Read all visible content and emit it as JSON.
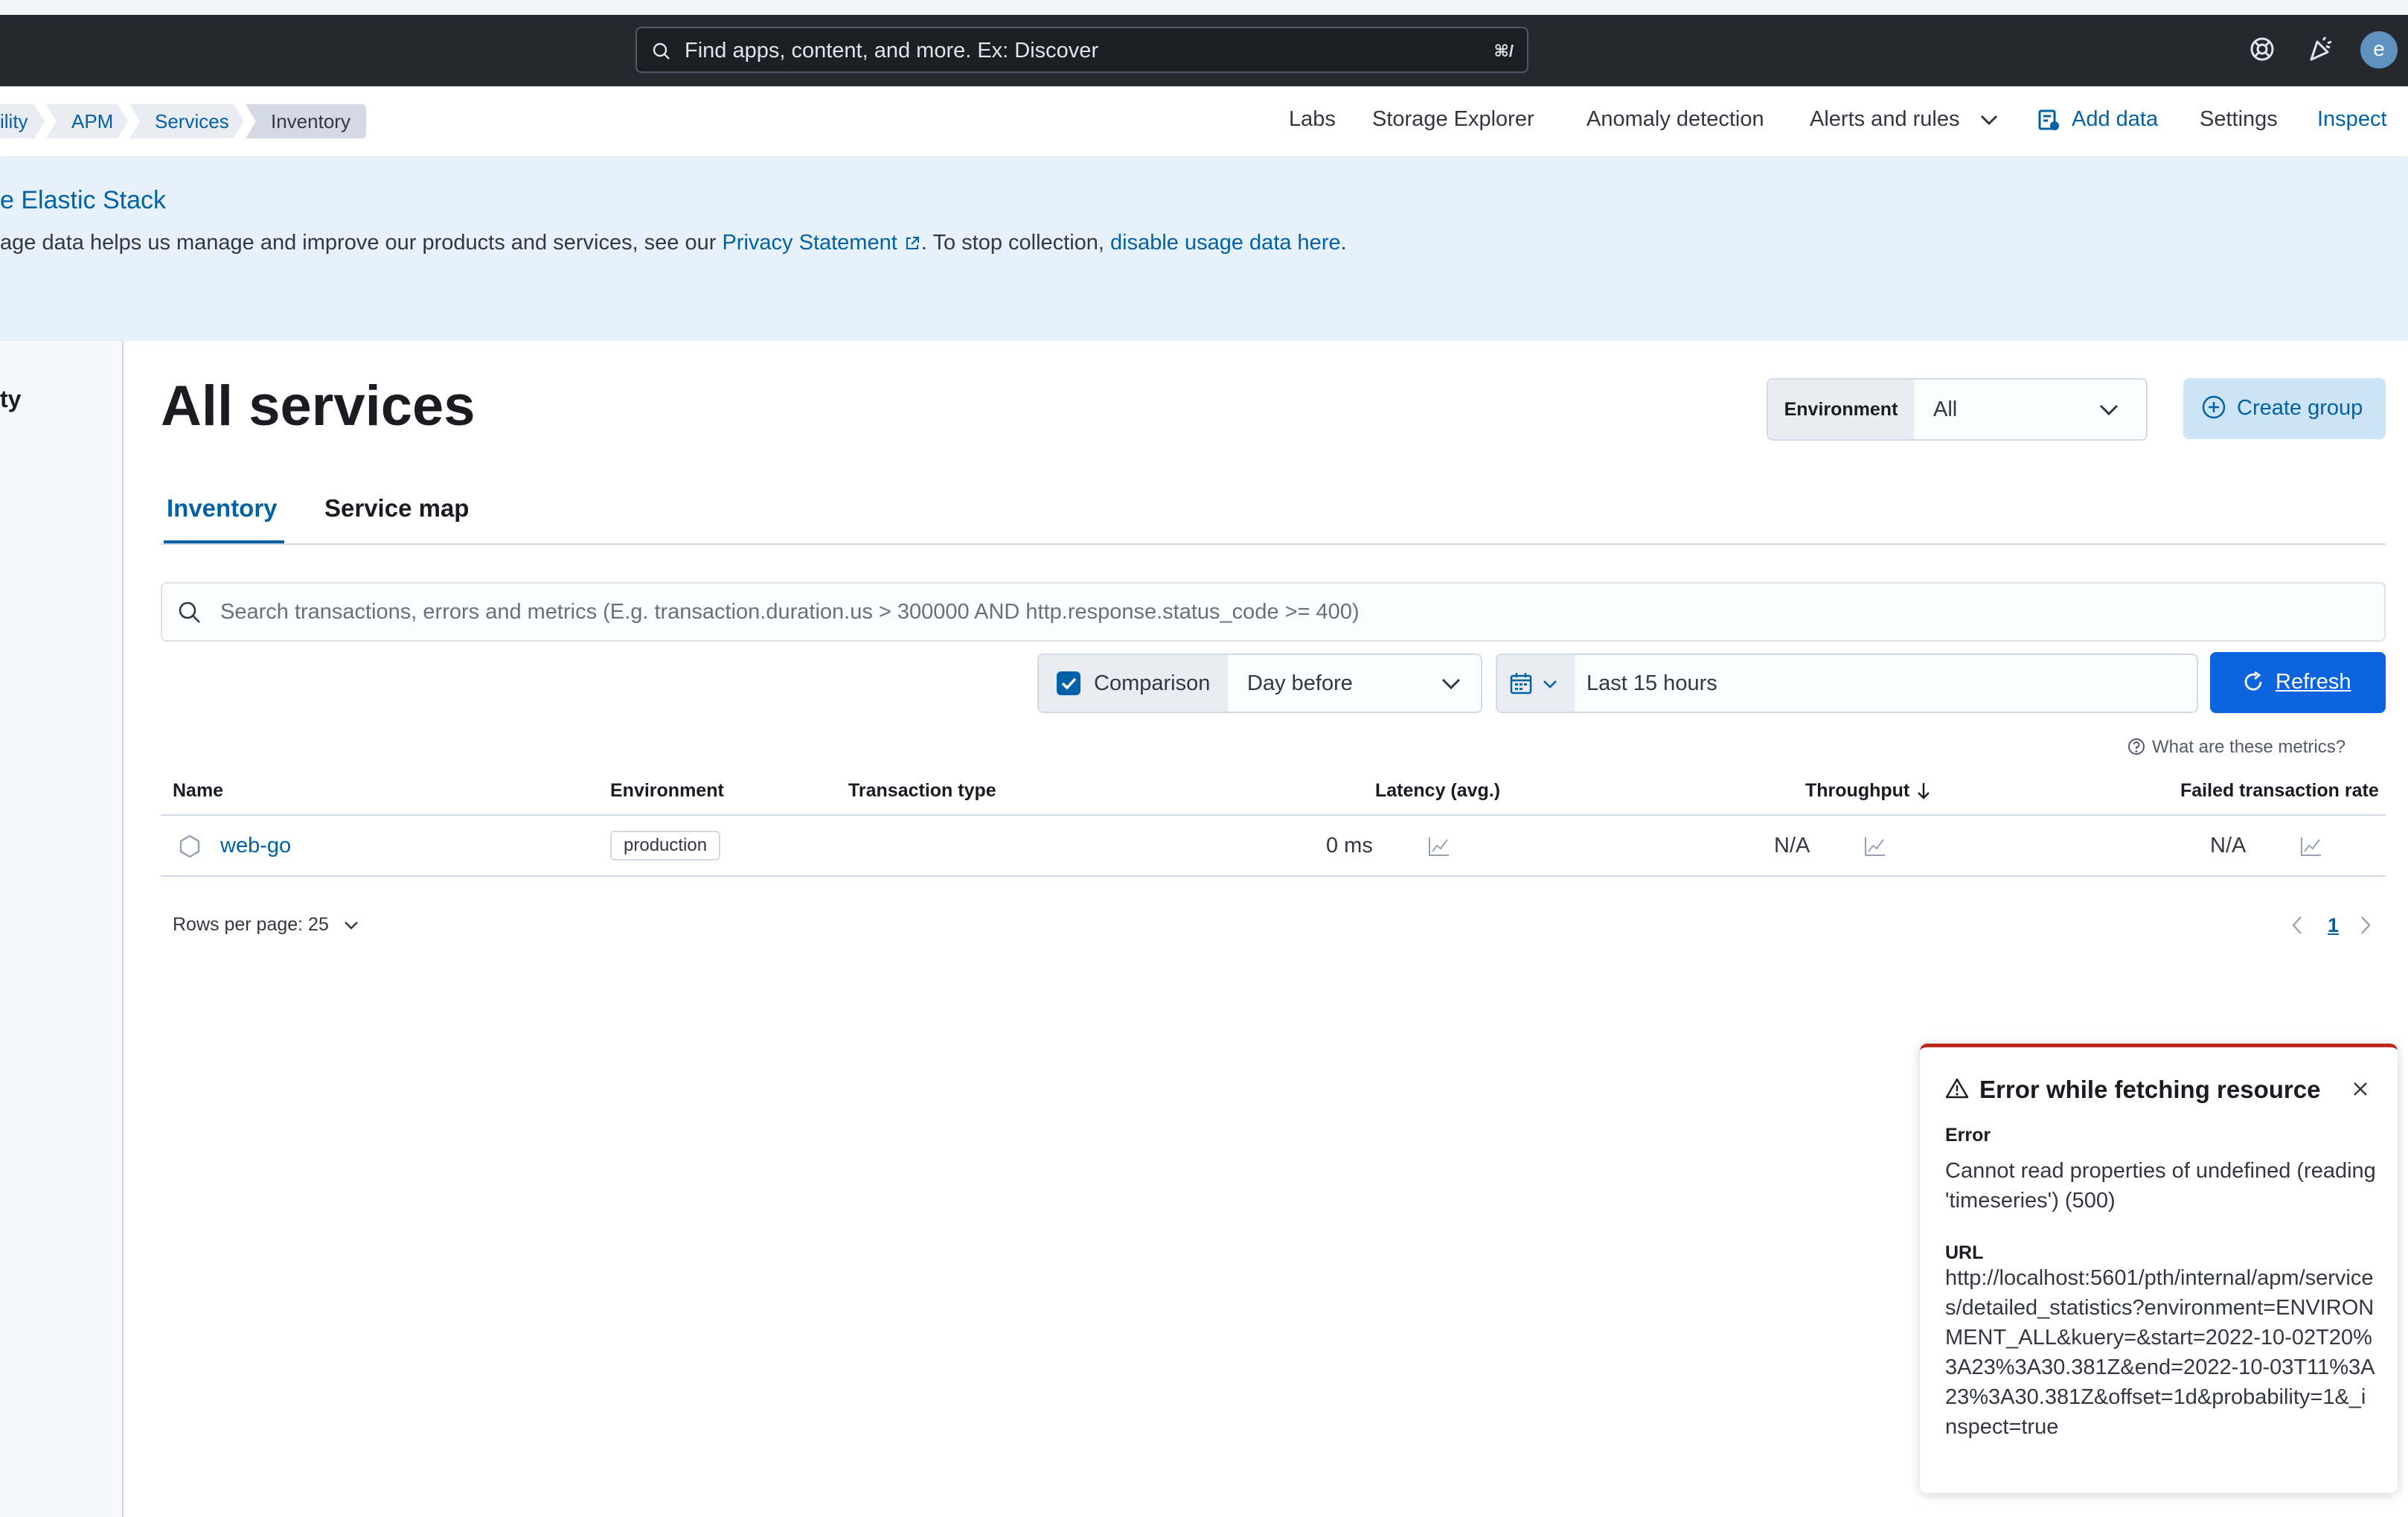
{
  "header": {
    "search_placeholder": "Find apps, content, and more. Ex: Discover",
    "search_shortcut": "⌘/",
    "avatar_initial": "e"
  },
  "breadcrumbs": [
    "ility",
    "APM",
    "Services",
    "Inventory"
  ],
  "nav": {
    "labs": "Labs",
    "storage_explorer": "Storage Explorer",
    "anomaly_detection": "Anomaly detection",
    "alerts_and_rules": "Alerts and rules",
    "add_data": "Add data",
    "settings": "Settings",
    "inspect": "Inspect"
  },
  "callout": {
    "title": "e Elastic Stack",
    "text_before": "age data helps us manage and improve our products and services, see our ",
    "privacy_link": "Privacy Statement",
    "text_middle": ". To stop collection, ",
    "disable_link": "disable usage data here",
    "text_end": "."
  },
  "sidenav": {
    "label": "ty"
  },
  "page": {
    "title": "All services",
    "environment_label": "Environment",
    "environment_value": "All",
    "create_group": "Create group"
  },
  "tabs": [
    {
      "label": "Inventory",
      "active": true
    },
    {
      "label": "Service map",
      "active": false
    }
  ],
  "kql_placeholder": "Search transactions, errors and metrics (E.g. transaction.duration.us > 300000 AND http.response.status_code >= 400)",
  "comparison": {
    "label": "Comparison",
    "checked": true,
    "value": "Day before"
  },
  "date_range": "Last 15 hours",
  "refresh": "Refresh",
  "metrics_help": "What are these metrics?",
  "table": {
    "columns": [
      "Name",
      "Environment",
      "Transaction type",
      "Latency (avg.)",
      "Throughput",
      "Failed transaction rate"
    ],
    "rows": [
      {
        "name": "web-go",
        "environment": "production",
        "transaction_type": "",
        "latency": "0 ms",
        "throughput": "N/A",
        "failed_rate": "N/A"
      }
    ],
    "rows_per_page": "Rows per page: 25",
    "page": "1"
  },
  "toast": {
    "title": "Error while fetching resource",
    "error_heading": "Error",
    "error_text": "Cannot read properties of undefined (reading 'timeseries') (500)",
    "url_heading": "URL",
    "url_text": "http://localhost:5601/pth/internal/apm/services/detailed_statistics?environment=ENVIRONMENT_ALL&kuery=&start=2022-10-02T20%3A23%3A30.381Z&end=2022-10-03T11%3A23%3A30.381Z&offset=1d&probability=1&_inspect=true"
  },
  "colors": {
    "header_bg": "#25282f",
    "accent": "#0061a6",
    "refresh_bg": "#0b64dd",
    "callout_bg": "#e6f1fa",
    "danger": "#bd271e"
  }
}
